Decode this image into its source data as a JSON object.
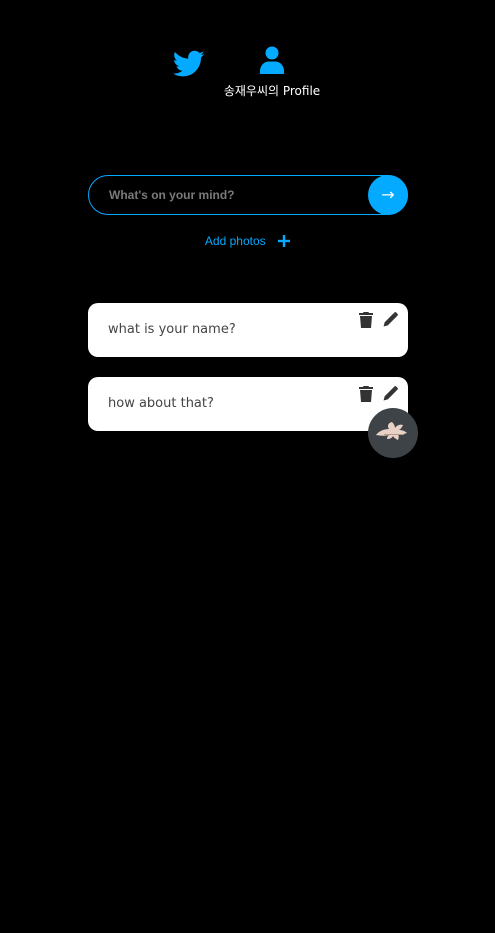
{
  "nav": {
    "home_icon": "twitter-bird-icon",
    "profile_icon": "user-icon",
    "profile_label": "송재우씨의 Profile",
    "accent_color": "#04aaff"
  },
  "compose": {
    "placeholder": "What's on your mind?",
    "value": "",
    "submit_label": "→",
    "add_photos_label": "Add photos",
    "add_photos_icon": "plus-icon"
  },
  "tweets": [
    {
      "text": "what is your name?",
      "actions": [
        "trash-icon",
        "pencil-icon"
      ]
    },
    {
      "text": "how about that?",
      "actions": [
        "trash-icon",
        "pencil-icon"
      ]
    }
  ],
  "attachment": {
    "icon": "leaf-thumbnail"
  }
}
